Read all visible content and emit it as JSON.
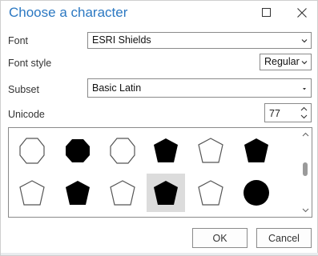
{
  "dialog": {
    "title": "Choose a character",
    "maximize_icon": "maximize-icon",
    "close_icon": "close-icon"
  },
  "font": {
    "label": "Font",
    "value": "ESRI Shields"
  },
  "font_style": {
    "label": "Font style",
    "value": "Regular"
  },
  "subset": {
    "label": "Subset",
    "value": "Basic Latin"
  },
  "unicode": {
    "label": "Unicode",
    "value": "77"
  },
  "glyphs": [
    {
      "icon": "hexagon-outline-icon",
      "selected": false
    },
    {
      "icon": "hexagon-filled-icon",
      "selected": false
    },
    {
      "icon": "hexagon-outline-icon",
      "selected": false
    },
    {
      "icon": "pentagon-filled-icon",
      "selected": false
    },
    {
      "icon": "pentagon-outline-icon",
      "selected": false
    },
    {
      "icon": "pentagon-filled-icon",
      "selected": false
    },
    {
      "icon": "pentagon-outline-icon",
      "selected": false
    },
    {
      "icon": "pentagon-filled-icon",
      "selected": false
    },
    {
      "icon": "pentagon-outline-icon",
      "selected": false
    },
    {
      "icon": "pentagon-filled-icon",
      "selected": true
    },
    {
      "icon": "pentagon-outline-icon",
      "selected": false
    },
    {
      "icon": "circle-filled-icon",
      "selected": false
    }
  ],
  "buttons": {
    "ok": "OK",
    "cancel": "Cancel"
  },
  "colors": {
    "title": "#2b78c2",
    "selected_cell": "#dcdcdc",
    "border": "#8a8a8a"
  }
}
